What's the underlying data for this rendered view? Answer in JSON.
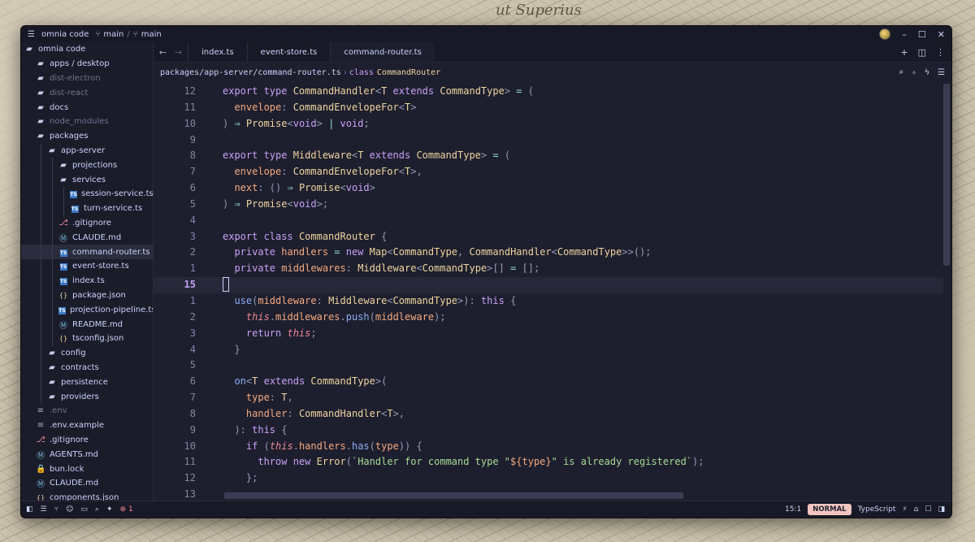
{
  "titlebar": {
    "project": "omnia code",
    "branch1": "main",
    "branch2": "main",
    "controls": [
      "minimize",
      "maximize",
      "close"
    ]
  },
  "sidebar": {
    "root": "omnia code",
    "items": [
      {
        "label": "apps / desktop",
        "icon": "folder-icon",
        "depth": 1,
        "dim": false
      },
      {
        "label": "dist-electron",
        "icon": "folder-icon",
        "depth": 1,
        "dim": true
      },
      {
        "label": "dist-react",
        "icon": "folder-icon",
        "depth": 1,
        "dim": true
      },
      {
        "label": "docs",
        "icon": "folder-icon",
        "depth": 1,
        "dim": false
      },
      {
        "label": "node_modules",
        "icon": "folder-icon",
        "depth": 1,
        "dim": true
      },
      {
        "label": "packages",
        "icon": "folder-open-icon",
        "depth": 1,
        "dim": false
      },
      {
        "label": "app-server",
        "icon": "folder-open-icon",
        "depth": 2,
        "dim": false
      },
      {
        "label": "projections",
        "icon": "folder-icon",
        "depth": 3,
        "dim": false
      },
      {
        "label": "services",
        "icon": "folder-open-icon",
        "depth": 3,
        "dim": false
      },
      {
        "label": "session-service.ts",
        "icon": "typescript-icon",
        "depth": 4,
        "dim": false
      },
      {
        "label": "turn-service.ts",
        "icon": "typescript-icon",
        "depth": 4,
        "dim": false
      },
      {
        "label": ".gitignore",
        "icon": "git-icon",
        "depth": 3,
        "dim": false
      },
      {
        "label": "CLAUDE.md",
        "icon": "markdown-icon",
        "depth": 3,
        "dim": false
      },
      {
        "label": "command-router.ts",
        "icon": "typescript-icon",
        "depth": 3,
        "dim": false,
        "active": true
      },
      {
        "label": "event-store.ts",
        "icon": "typescript-icon",
        "depth": 3,
        "dim": false
      },
      {
        "label": "index.ts",
        "icon": "typescript-icon",
        "depth": 3,
        "dim": false
      },
      {
        "label": "package.json",
        "icon": "json-icon",
        "depth": 3,
        "dim": false
      },
      {
        "label": "projection-pipeline.ts",
        "icon": "typescript-icon",
        "depth": 3,
        "dim": false
      },
      {
        "label": "README.md",
        "icon": "markdown-icon",
        "depth": 3,
        "dim": false
      },
      {
        "label": "tsconfig.json",
        "icon": "json-icon",
        "depth": 3,
        "dim": false
      },
      {
        "label": "config",
        "icon": "folder-icon",
        "depth": 2,
        "dim": false
      },
      {
        "label": "contracts",
        "icon": "folder-icon",
        "depth": 2,
        "dim": false
      },
      {
        "label": "persistence",
        "icon": "folder-icon",
        "depth": 2,
        "dim": false
      },
      {
        "label": "providers",
        "icon": "folder-icon",
        "depth": 2,
        "dim": false
      },
      {
        "label": ".env",
        "icon": "env-icon",
        "depth": 1,
        "dim": true
      },
      {
        "label": ".env.example",
        "icon": "env-icon",
        "depth": 1,
        "dim": false
      },
      {
        "label": ".gitignore",
        "icon": "git-icon",
        "depth": 1,
        "dim": false
      },
      {
        "label": "AGENTS.md",
        "icon": "markdown-icon",
        "depth": 1,
        "dim": false
      },
      {
        "label": "bun.lock",
        "icon": "lock-icon",
        "depth": 1,
        "dim": false
      },
      {
        "label": "CLAUDE.md",
        "icon": "markdown-icon",
        "depth": 1,
        "dim": false
      },
      {
        "label": "components.json",
        "icon": "json-icon",
        "depth": 1,
        "dim": false
      }
    ]
  },
  "tabs": [
    {
      "label": "index.ts",
      "active": false
    },
    {
      "label": "event-store.ts",
      "active": false
    },
    {
      "label": "command-router.ts",
      "active": true
    }
  ],
  "breadcrumb": {
    "path": "packages/app-server/command-router.ts",
    "keyword": "class",
    "symbol": "CommandRouter"
  },
  "editor": {
    "current_line_index": 12,
    "lines": [
      {
        "n": "12",
        "tokens": [
          [
            "k",
            "export "
          ],
          [
            "k",
            "type "
          ],
          [
            "ty",
            "CommandHandler"
          ],
          [
            "pu",
            "<"
          ],
          [
            "ty",
            "T "
          ],
          [
            "k",
            "extends "
          ],
          [
            "ty",
            "CommandType"
          ],
          [
            "pu",
            "> "
          ],
          [
            "op",
            "= "
          ],
          [
            "pu",
            "("
          ]
        ]
      },
      {
        "n": "11",
        "tokens": [
          [
            "pr",
            "  envelope"
          ],
          [
            "pu",
            ": "
          ],
          [
            "ty",
            "CommandEnvelopeFor"
          ],
          [
            "pu",
            "<"
          ],
          [
            "ty",
            "T"
          ],
          [
            "pu",
            ">"
          ]
        ]
      },
      {
        "n": "10",
        "tokens": [
          [
            "pu",
            ") "
          ],
          [
            "op",
            "⇒ "
          ],
          [
            "ty",
            "Promise"
          ],
          [
            "pu",
            "<"
          ],
          [
            "k",
            "void"
          ],
          [
            "pu",
            "> "
          ],
          [
            "op",
            "| "
          ],
          [
            "k",
            "void"
          ],
          [
            "pu",
            ";"
          ]
        ]
      },
      {
        "n": "9",
        "tokens": []
      },
      {
        "n": "8",
        "tokens": [
          [
            "k",
            "export "
          ],
          [
            "k",
            "type "
          ],
          [
            "ty",
            "Middleware"
          ],
          [
            "pu",
            "<"
          ],
          [
            "ty",
            "T "
          ],
          [
            "k",
            "extends "
          ],
          [
            "ty",
            "CommandType"
          ],
          [
            "pu",
            "> "
          ],
          [
            "op",
            "= "
          ],
          [
            "pu",
            "("
          ]
        ]
      },
      {
        "n": "7",
        "tokens": [
          [
            "pr",
            "  envelope"
          ],
          [
            "pu",
            ": "
          ],
          [
            "ty",
            "CommandEnvelopeFor"
          ],
          [
            "pu",
            "<"
          ],
          [
            "ty",
            "T"
          ],
          [
            "pu",
            ">,"
          ]
        ]
      },
      {
        "n": "6",
        "tokens": [
          [
            "pr",
            "  next"
          ],
          [
            "pu",
            ": () "
          ],
          [
            "op",
            "⇒ "
          ],
          [
            "ty",
            "Promise"
          ],
          [
            "pu",
            "<"
          ],
          [
            "k",
            "void"
          ],
          [
            "pu",
            ">"
          ]
        ]
      },
      {
        "n": "5",
        "tokens": [
          [
            "pu",
            ") "
          ],
          [
            "op",
            "⇒ "
          ],
          [
            "ty",
            "Promise"
          ],
          [
            "pu",
            "<"
          ],
          [
            "k",
            "void"
          ],
          [
            "pu",
            ">;"
          ]
        ]
      },
      {
        "n": "4",
        "tokens": []
      },
      {
        "n": "3",
        "tokens": [
          [
            "k",
            "export "
          ],
          [
            "k",
            "class "
          ],
          [
            "ty",
            "CommandRouter "
          ],
          [
            "pu",
            "{"
          ]
        ]
      },
      {
        "n": "2",
        "tokens": [
          [
            "k",
            "  private "
          ],
          [
            "pr",
            "handlers "
          ],
          [
            "op",
            "= "
          ],
          [
            "k",
            "new "
          ],
          [
            "ty",
            "Map"
          ],
          [
            "pu",
            "<"
          ],
          [
            "ty",
            "CommandType"
          ],
          [
            "pu",
            ", "
          ],
          [
            "ty",
            "CommandHandler"
          ],
          [
            "pu",
            "<"
          ],
          [
            "ty",
            "CommandType"
          ],
          [
            "pu",
            ">>();"
          ]
        ]
      },
      {
        "n": "1",
        "tokens": [
          [
            "k",
            "  private "
          ],
          [
            "pr",
            "middlewares"
          ],
          [
            "pu",
            ": "
          ],
          [
            "ty",
            "Middleware"
          ],
          [
            "pu",
            "<"
          ],
          [
            "ty",
            "CommandType"
          ],
          [
            "pu",
            ">[] "
          ],
          [
            "op",
            "= "
          ],
          [
            "pu",
            "[];"
          ]
        ]
      },
      {
        "n": "15",
        "tokens": []
      },
      {
        "n": "1",
        "tokens": [
          [
            "fn",
            "  use"
          ],
          [
            "pu",
            "("
          ],
          [
            "pr",
            "middleware"
          ],
          [
            "pu",
            ": "
          ],
          [
            "ty",
            "Middleware"
          ],
          [
            "pu",
            "<"
          ],
          [
            "ty",
            "CommandType"
          ],
          [
            "pu",
            ">): "
          ],
          [
            "k",
            "this "
          ],
          [
            "pu",
            "{"
          ]
        ]
      },
      {
        "n": "2",
        "tokens": [
          [
            "th",
            "    this"
          ],
          [
            "pu",
            "."
          ],
          [
            "pr",
            "middlewares"
          ],
          [
            "pu",
            "."
          ],
          [
            "fn",
            "push"
          ],
          [
            "pu",
            "("
          ],
          [
            "pr",
            "middleware"
          ],
          [
            "pu",
            ");"
          ]
        ]
      },
      {
        "n": "3",
        "tokens": [
          [
            "k",
            "    return "
          ],
          [
            "th",
            "this"
          ],
          [
            "pu",
            ";"
          ]
        ]
      },
      {
        "n": "4",
        "tokens": [
          [
            "pu",
            "  }"
          ]
        ]
      },
      {
        "n": "5",
        "tokens": []
      },
      {
        "n": "6",
        "tokens": [
          [
            "fn",
            "  on"
          ],
          [
            "pu",
            "<"
          ],
          [
            "ty",
            "T "
          ],
          [
            "k",
            "extends "
          ],
          [
            "ty",
            "CommandType"
          ],
          [
            "pu",
            ">("
          ]
        ]
      },
      {
        "n": "7",
        "tokens": [
          [
            "pr",
            "    type"
          ],
          [
            "pu",
            ": "
          ],
          [
            "ty",
            "T"
          ],
          [
            "pu",
            ","
          ]
        ]
      },
      {
        "n": "8",
        "tokens": [
          [
            "pr",
            "    handler"
          ],
          [
            "pu",
            ": "
          ],
          [
            "ty",
            "CommandHandler"
          ],
          [
            "pu",
            "<"
          ],
          [
            "ty",
            "T"
          ],
          [
            "pu",
            ">,"
          ]
        ]
      },
      {
        "n": "9",
        "tokens": [
          [
            "pu",
            "  ): "
          ],
          [
            "k",
            "this "
          ],
          [
            "pu",
            "{"
          ]
        ]
      },
      {
        "n": "10",
        "tokens": [
          [
            "k",
            "    if "
          ],
          [
            "pu",
            "("
          ],
          [
            "th",
            "this"
          ],
          [
            "pu",
            "."
          ],
          [
            "pr",
            "handlers"
          ],
          [
            "pu",
            "."
          ],
          [
            "fn",
            "has"
          ],
          [
            "pu",
            "("
          ],
          [
            "pr",
            "type"
          ],
          [
            "pu",
            ")) {"
          ]
        ]
      },
      {
        "n": "11",
        "tokens": [
          [
            "k",
            "      throw "
          ],
          [
            "k",
            "new "
          ],
          [
            "ty",
            "Error"
          ],
          [
            "pu",
            "("
          ],
          [
            "st",
            "`Handler for command type \""
          ],
          [
            "pr",
            "${type}"
          ],
          [
            "st",
            "\" is already registered`"
          ],
          [
            "pu",
            ");"
          ]
        ]
      },
      {
        "n": "12",
        "tokens": [
          [
            "pu",
            "    };"
          ]
        ]
      },
      {
        "n": "13",
        "tokens": []
      }
    ]
  },
  "statusbar": {
    "errors": "1",
    "position": "15:1",
    "mode": "NORMAL",
    "language": "TypeScript"
  },
  "colors": {
    "window_bg": "#1e1f2e",
    "keyword": "#c6a0f6",
    "type": "#eed49f",
    "property": "#f5a97f",
    "function": "#8aadf4",
    "string": "#a6da95",
    "mode_badge": "#f4c5c0"
  }
}
